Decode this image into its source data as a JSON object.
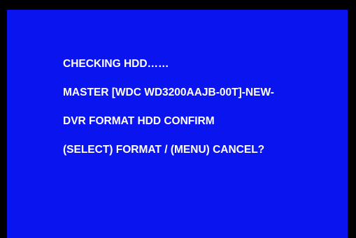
{
  "screen": {
    "background_color": "#0a14ee",
    "text_color": "#ffffff",
    "lines": [
      "CHECKING HDD……",
      "MASTER [WDC WD3200AAJB-00T]-NEW-",
      "DVR FORMAT HDD CONFIRM",
      "(SELECT) FORMAT / (MENU) CANCEL?"
    ]
  }
}
